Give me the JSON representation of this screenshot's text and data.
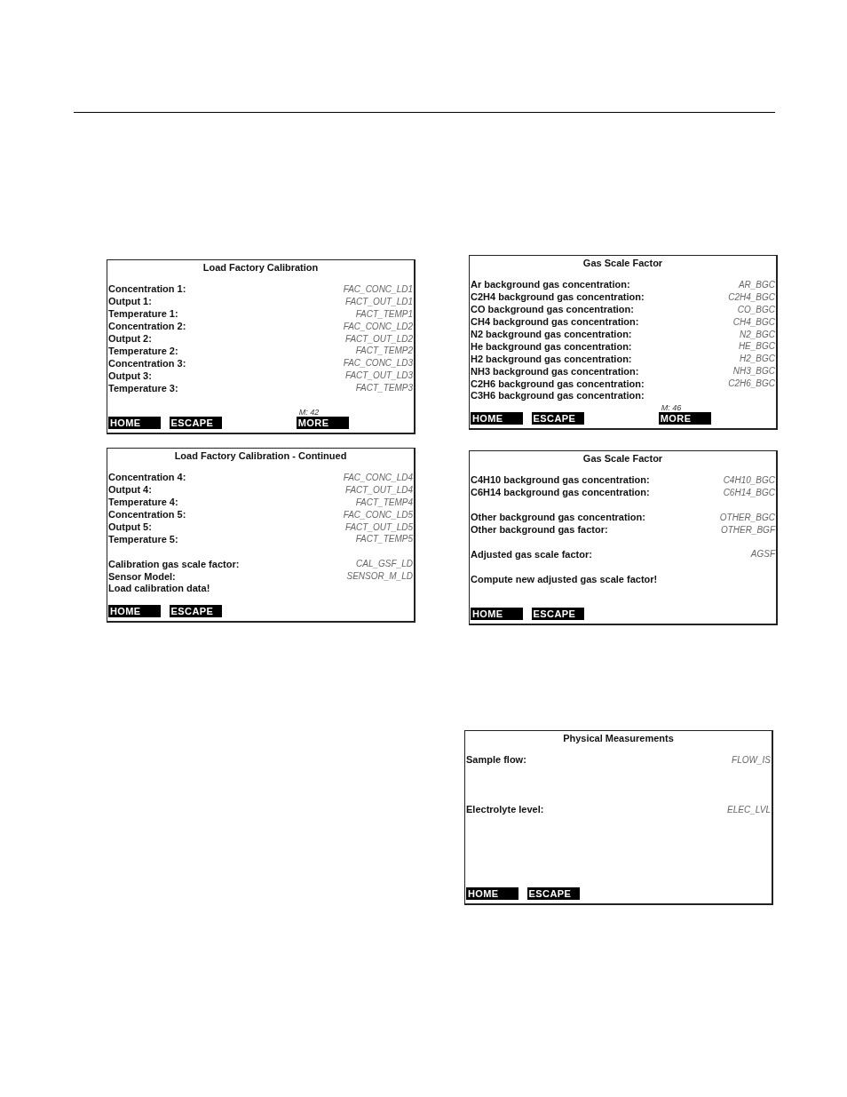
{
  "columns": [
    {
      "screens": [
        {
          "title": "Load Factory Calibration",
          "rows": [
            {
              "kind": "field",
              "label": "Concentration 1:",
              "value": "FAC_CONC_LD1"
            },
            {
              "kind": "field",
              "label": "Output 1:",
              "value": "FACT_OUT_LD1"
            },
            {
              "kind": "field",
              "label": "Temperature 1:",
              "value": "FACT_TEMP1"
            },
            {
              "kind": "field",
              "label": "Concentration 2:",
              "value": "FAC_CONC_LD2"
            },
            {
              "kind": "field",
              "label": "Output 2:",
              "value": "FACT_OUT_LD2"
            },
            {
              "kind": "field",
              "label": "Temperature 2:",
              "value": "FACT_TEMP2"
            },
            {
              "kind": "field",
              "label": "Concentration 3:",
              "value": "FAC_CONC_LD3"
            },
            {
              "kind": "field",
              "label": "Output 3:",
              "value": "FACT_OUT_LD3"
            },
            {
              "kind": "field",
              "label": "Temperature 3:",
              "value": "FACT_TEMP3"
            }
          ],
          "menu_id": "M: 42",
          "softkeys": [
            {
              "kind": "home",
              "label": "HOME"
            },
            {
              "kind": "escape",
              "label": "ESCAPE"
            },
            {
              "kind": "more",
              "label": "MORE"
            }
          ]
        },
        {
          "title": "Load Factory Calibration - Continued",
          "rows": [
            {
              "kind": "field",
              "label": "Concentration 4:",
              "value": "FAC_CONC_LD4"
            },
            {
              "kind": "field",
              "label": "Output 4:",
              "value": "FACT_OUT_LD4"
            },
            {
              "kind": "field",
              "label": "Temperature 4:",
              "value": "FACT_TEMP4"
            },
            {
              "kind": "field",
              "label": "Concentration 5:",
              "value": "FAC_CONC_LD5"
            },
            {
              "kind": "field",
              "label": "Output 5:",
              "value": "FACT_OUT_LD5"
            },
            {
              "kind": "field",
              "label": "Temperature 5:",
              "value": "FACT_TEMP5"
            },
            {
              "kind": "spacer"
            },
            {
              "kind": "field",
              "label": "Calibration gas scale factor:",
              "value": "CAL_GSF_LD"
            },
            {
              "kind": "field",
              "label": "Sensor Model:",
              "value": "SENSOR_M_LD"
            },
            {
              "kind": "field",
              "label": "Load calibration data!"
            }
          ],
          "softkeys": [
            {
              "kind": "home",
              "label": "HOME"
            },
            {
              "kind": "escape",
              "label": "ESCAPE"
            }
          ]
        }
      ]
    },
    {
      "screens": [
        {
          "title": "Gas Scale Factor",
          "rows": [
            {
              "kind": "field",
              "label": "Ar background gas concentration:",
              "value": "AR_BGC"
            },
            {
              "kind": "field",
              "label": "C2H4 background gas concentration:",
              "value": "C2H4_BGC"
            },
            {
              "kind": "field",
              "label": "CO background gas concentration:",
              "value": "CO_BGC"
            },
            {
              "kind": "field",
              "label": "CH4 background gas concentration:",
              "value": "CH4_BGC"
            },
            {
              "kind": "field",
              "label": "N2 background gas concentration:",
              "value": "N2_BGC"
            },
            {
              "kind": "field",
              "label": "He background gas concentration:",
              "value": "HE_BGC"
            },
            {
              "kind": "field",
              "label": "H2 background gas concentration:",
              "value": "H2_BGC"
            },
            {
              "kind": "field",
              "label": "NH3 background gas concentration:",
              "value": "NH3_BGC"
            },
            {
              "kind": "field",
              "label": "C2H6 background gas concentration:",
              "value": "C2H6_BGC"
            },
            {
              "kind": "field",
              "label": "C3H6 background gas concentration:"
            }
          ],
          "menu_id": "M: 46",
          "softkeys": [
            {
              "kind": "home",
              "label": "HOME"
            },
            {
              "kind": "escape",
              "label": "ESCAPE"
            },
            {
              "kind": "more",
              "label": "MORE"
            }
          ]
        },
        {
          "title": "Gas Scale Factor",
          "rows": [
            {
              "kind": "field",
              "label": "C4H10 background gas concentration:",
              "value": "C4H10_BGC"
            },
            {
              "kind": "field",
              "label": "C6H14 background gas concentration:",
              "value": "C6H14_BGC"
            },
            {
              "kind": "spacer"
            },
            {
              "kind": "field",
              "label": "Other background gas concentration:",
              "value": "OTHER_BGC"
            },
            {
              "kind": "field",
              "label": "Other background gas factor:",
              "value": "OTHER_BGF"
            },
            {
              "kind": "spacer"
            },
            {
              "kind": "field",
              "label": "Adjusted gas scale factor:",
              "value": "AGSF"
            },
            {
              "kind": "spacer"
            },
            {
              "kind": "field",
              "label": "Compute new adjusted gas scale factor!"
            }
          ],
          "softkeys": [
            {
              "kind": "home",
              "label": "HOME"
            },
            {
              "kind": "escape",
              "label": "ESCAPE"
            }
          ]
        },
        {
          "title": "Physical Measurements",
          "rows": [
            {
              "kind": "field",
              "label": "Sample flow:",
              "value": "FLOW_IS"
            },
            {
              "kind": "spacer"
            },
            {
              "kind": "spacer"
            },
            {
              "kind": "spacer"
            },
            {
              "kind": "field",
              "label": "Electrolyte level:",
              "value": "ELEC_LVL"
            }
          ],
          "softkeys": [
            {
              "kind": "home",
              "label": "HOME"
            },
            {
              "kind": "escape",
              "label": "ESCAPE"
            }
          ]
        }
      ]
    }
  ]
}
